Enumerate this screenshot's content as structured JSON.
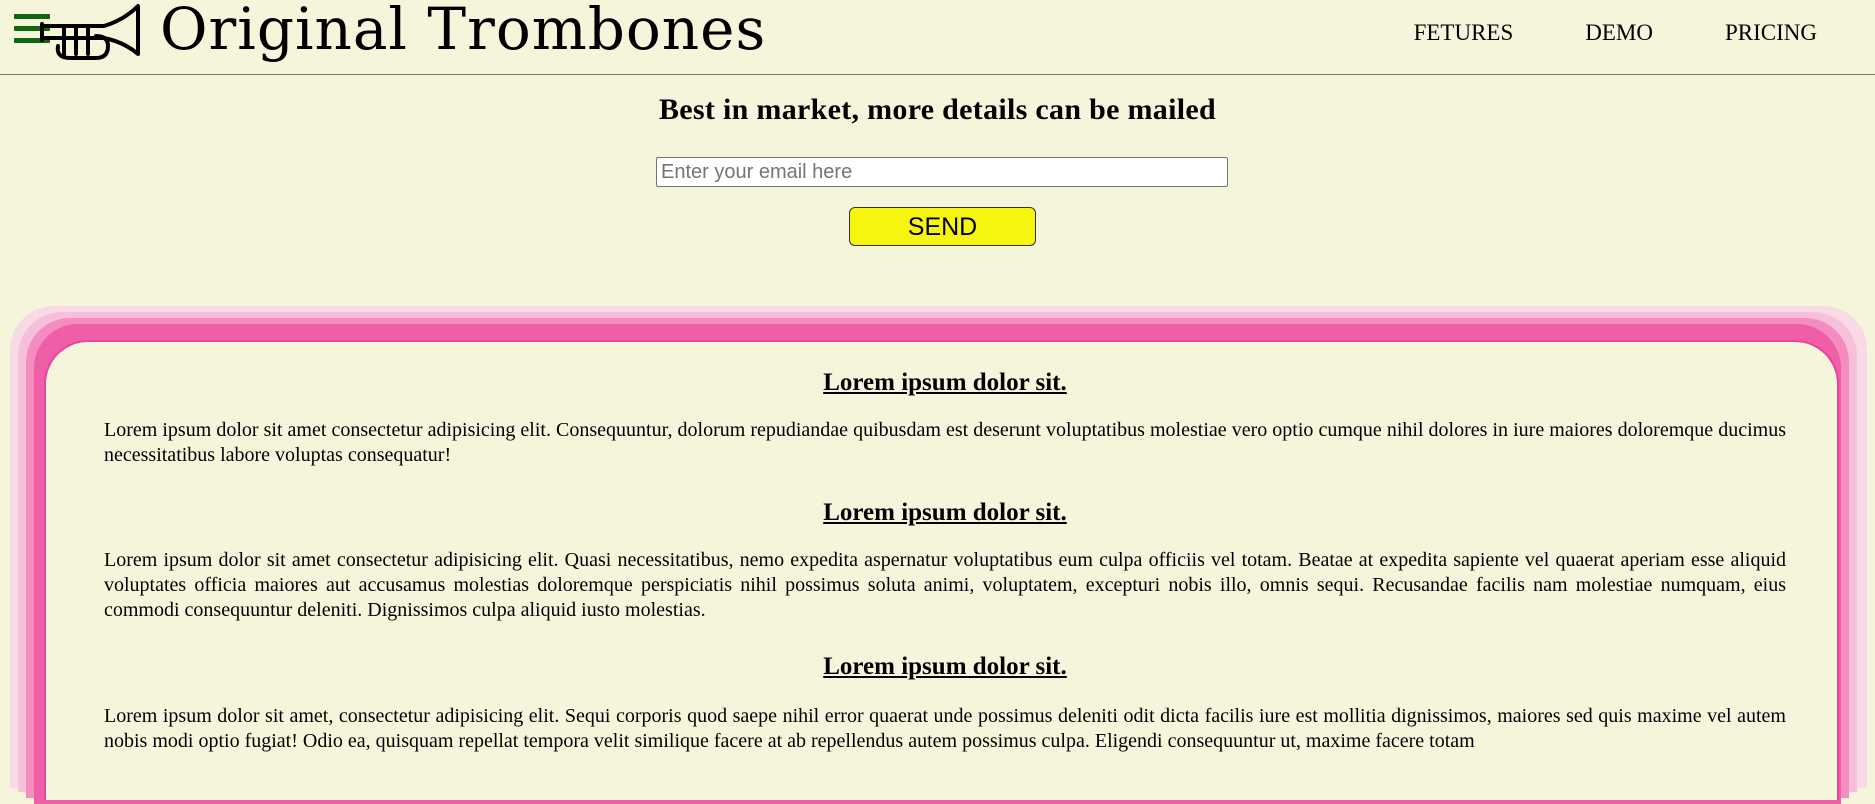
{
  "header": {
    "brand": "Original Trombones",
    "nav": [
      "FETURES",
      "DEMO",
      "PRICING"
    ]
  },
  "hero": {
    "title": "Best in market, more details can be mailed",
    "email_placeholder": "Enter your email here",
    "email_value": "",
    "send_label": "SEND"
  },
  "content": {
    "sections": [
      {
        "heading": "Lorem ipsum dolor sit.",
        "text": "Lorem ipsum dolor sit amet consectetur adipisicing elit. Consequuntur, dolorum repudiandae quibusdam est deserunt voluptatibus molestiae vero optio cumque nihil dolores in iure maiores doloremque ducimus necessitatibus labore voluptas consequatur!"
      },
      {
        "heading": "Lorem ipsum dolor sit.",
        "text": "Lorem ipsum dolor sit amet consectetur adipisicing elit. Quasi necessitatibus, nemo expedita aspernatur voluptatibus eum culpa officiis vel totam. Beatae at expedita sapiente vel quaerat aperiam esse aliquid voluptates officia maiores aut accusamus molestias doloremque perspiciatis nihil possimus soluta animi, voluptatem, excepturi nobis illo, omnis sequi. Recusandae facilis nam molestiae numquam, eius commodi consequuntur deleniti. Dignissimos culpa aliquid iusto molestias."
      },
      {
        "heading": "Lorem ipsum dolor sit.",
        "text": "Lorem ipsum dolor sit amet, consectetur adipisicing elit. Sequi corporis quod saepe nihil error quaerat unde possimus deleniti odit dicta facilis iure est mollitia dignissimos, maiores sed quis maxime vel autem nobis modi optio fugiat! Odio ea, quisquam repellat tempora velit similique facere at ab repellendus autem possimus culpa. Eligendi consequuntur ut, maxime facere totam"
      }
    ]
  },
  "colors": {
    "background": "#f5f5dc",
    "accent_button": "#f5f50f",
    "card_border": "#e8449a",
    "menu_icon": "#116611"
  },
  "icons": [
    "hamburger-menu-icon",
    "trumpet-logo-icon"
  ]
}
